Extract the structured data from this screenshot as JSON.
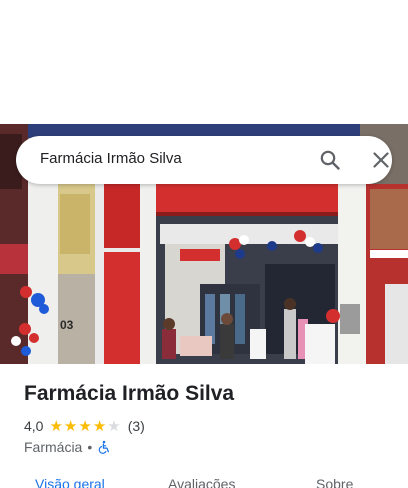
{
  "search": {
    "query": "Farmácia Irmão Silva",
    "search_icon": "search-icon",
    "close_icon": "close-icon"
  },
  "photo": {
    "storefront_number": "03"
  },
  "place": {
    "name": "Farmácia Irmão Silva",
    "rating_value": "4,0",
    "stars_filled": 4,
    "stars_total": 5,
    "review_count": "(3)",
    "category": "Farmácia",
    "separator": "•",
    "accessibility_icon": "wheelchair-icon"
  },
  "tabs": [
    {
      "label": "Visão geral",
      "active": true
    },
    {
      "label": "Avaliações",
      "active": false
    },
    {
      "label": "Sobre",
      "active": false
    }
  ],
  "colors": {
    "accent": "#1a73e8",
    "star": "#fbbc04",
    "star_empty": "#dadce0",
    "awning_red": "#d32f2f"
  }
}
